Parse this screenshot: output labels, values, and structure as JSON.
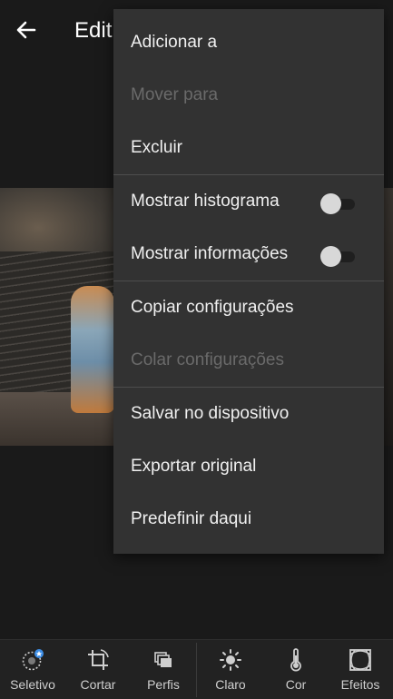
{
  "header": {
    "title": "Edit"
  },
  "menu": {
    "items": [
      {
        "label": "Adicionar a",
        "enabled": true
      },
      {
        "label": "Mover para",
        "enabled": false
      },
      {
        "label": "Excluir",
        "enabled": true
      },
      {
        "label": "Mostrar histograma",
        "enabled": true,
        "toggle": false
      },
      {
        "label": "Mostrar informações",
        "enabled": true,
        "toggle": false
      },
      {
        "label": "Copiar configurações",
        "enabled": true
      },
      {
        "label": "Colar configurações",
        "enabled": false
      },
      {
        "label": "Salvar no dispositivo",
        "enabled": true
      },
      {
        "label": "Exportar original",
        "enabled": true
      },
      {
        "label": "Predefinir daqui",
        "enabled": true
      }
    ]
  },
  "toolbar": {
    "tools": [
      {
        "label": "Seletivo",
        "icon": "selective-icon"
      },
      {
        "label": "Cortar",
        "icon": "crop-icon"
      },
      {
        "label": "Perfis",
        "icon": "profiles-icon"
      },
      {
        "label": "Claro",
        "icon": "light-icon"
      },
      {
        "label": "Cor",
        "icon": "color-temperature-icon"
      },
      {
        "label": "Efeitos",
        "icon": "effects-icon"
      }
    ]
  },
  "colors": {
    "menu_bg": "#323232",
    "app_bg": "#1a1a1a",
    "badge": "#3d8ee6"
  }
}
